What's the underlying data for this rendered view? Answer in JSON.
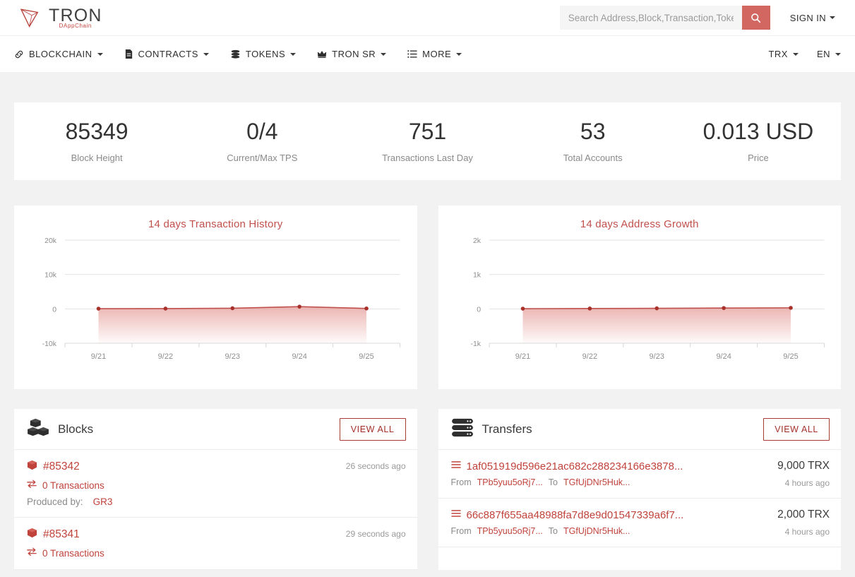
{
  "brand": {
    "name": "TRON",
    "subtitle": "DAppChain",
    "accent": "#c0504d",
    "accent_dark": "#a33028",
    "search_btn_color": "#d26761"
  },
  "header": {
    "search": {
      "placeholder": "Search Address,Block,Transaction,Token",
      "value": "",
      "icon": "search-icon"
    },
    "sign_in": "SIGN IN"
  },
  "nav": {
    "items": [
      {
        "label": "BLOCKCHAIN",
        "icon": "link-icon"
      },
      {
        "label": "CONTRACTS",
        "icon": "file-icon"
      },
      {
        "label": "TOKENS",
        "icon": "coins-icon"
      },
      {
        "label": "TRON SR",
        "icon": "crown-icon"
      },
      {
        "label": "MORE",
        "icon": "list-icon"
      }
    ],
    "right": [
      {
        "label": "TRX"
      },
      {
        "label": "EN"
      }
    ]
  },
  "stats": [
    {
      "value": "85349",
      "label": "Block Height"
    },
    {
      "value": "0/4",
      "label": "Current/Max TPS"
    },
    {
      "value": "751",
      "label": "Transactions Last Day"
    },
    {
      "value": "53",
      "label": "Total Accounts"
    },
    {
      "value": "0.013 USD",
      "label": "Price"
    }
  ],
  "chart_data": [
    {
      "type": "area",
      "title": "14 days Transaction History",
      "xlabel": "",
      "ylabel": "",
      "categories": [
        "9/21",
        "9/22",
        "9/23",
        "9/24",
        "9/25"
      ],
      "values": [
        60,
        80,
        180,
        650,
        120
      ],
      "ylim": [
        -10000,
        20000
      ],
      "yticks": [
        20000,
        10000,
        0,
        -10000
      ],
      "ytick_labels": [
        "20k",
        "10k",
        "0",
        "-10k"
      ],
      "grid": true,
      "legend": "none",
      "line_color": "#c0504d",
      "point_color": "#a8322b",
      "fill_color": "#e8a9a5"
    },
    {
      "type": "area",
      "title": "14 days Address Growth",
      "xlabel": "",
      "ylabel": "",
      "categories": [
        "9/21",
        "9/22",
        "9/23",
        "9/24",
        "9/25"
      ],
      "values": [
        6,
        10,
        16,
        24,
        30
      ],
      "ylim": [
        -1000,
        2000
      ],
      "yticks": [
        2000,
        1000,
        0,
        -1000
      ],
      "ytick_labels": [
        "2k",
        "1k",
        "0",
        "-1k"
      ],
      "grid": true,
      "legend": "none",
      "line_color": "#c0504d",
      "point_color": "#a8322b",
      "fill_color": "#e8a9a5"
    }
  ],
  "blocks_panel": {
    "title": "Blocks",
    "icon": "cubes-icon",
    "view_all": "VIEW ALL",
    "rows": [
      {
        "id": "#85342",
        "transactions": "0 Transactions",
        "produced_label": "Produced by:",
        "producer": "GR3",
        "time": "26 seconds ago"
      },
      {
        "id": "#85341",
        "transactions": "0 Transactions",
        "produced_label": "",
        "producer": "",
        "time": "29 seconds ago"
      }
    ]
  },
  "transfers_panel": {
    "title": "Transfers",
    "icon": "server-icon",
    "view_all": "VIEW ALL",
    "rows": [
      {
        "hash": "1af051919d596e21ac682c288234166e3878...",
        "from_label": "From",
        "from": "TPb5yuu5oRj7...",
        "to_label": "To",
        "to": "TGfUjDNr5Huk...",
        "amount": "9,000 TRX",
        "time": "4 hours ago"
      },
      {
        "hash": "66c887f655aa48988fa7d8e9d01547339a6f7...",
        "from_label": "From",
        "from": "TPb5yuu5oRj7...",
        "to_label": "To",
        "to": "TGfUjDNr5Huk...",
        "amount": "2,000 TRX",
        "time": "4 hours ago"
      }
    ]
  }
}
